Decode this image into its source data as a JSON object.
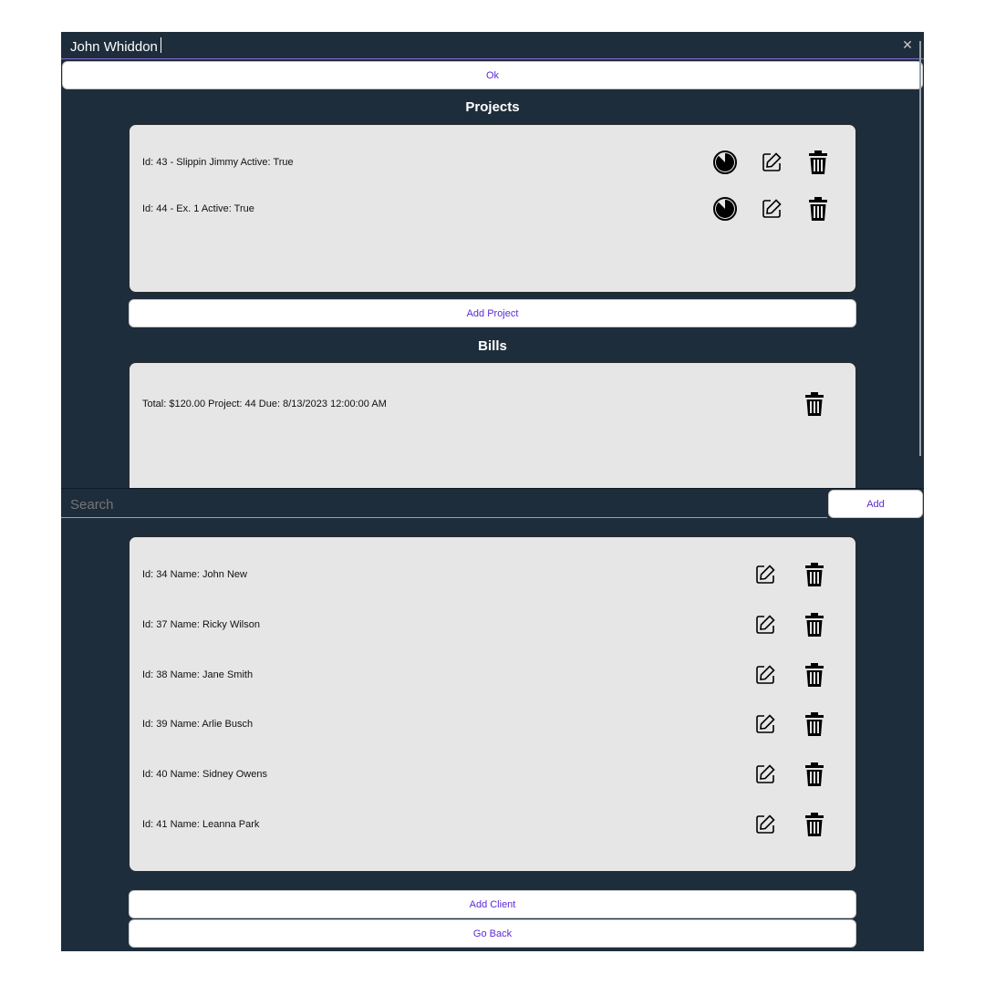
{
  "client_edit": {
    "name_value": "John Whiddon",
    "ok_label": "Ok"
  },
  "projects": {
    "title": "Projects",
    "items": [
      {
        "label": "Id: 43 - Slippin Jimmy Active: True"
      },
      {
        "label": "Id: 44 - Ex. 1 Active: True"
      }
    ],
    "add_label": "Add Project"
  },
  "bills": {
    "title": "Bills",
    "items": [
      {
        "label": "Total: $120.00 Project: 44 Due: 8/13/2023 12:00:00 AM"
      }
    ]
  },
  "clients": {
    "search_placeholder": "Search",
    "add_label": "Add",
    "items": [
      {
        "label": "Id: 34 Name: John New"
      },
      {
        "label": "Id: 37 Name: Ricky Wilson"
      },
      {
        "label": "Id: 38 Name: Jane Smith"
      },
      {
        "label": "Id: 39 Name: Arlie Busch"
      },
      {
        "label": "Id: 40 Name: Sidney Owens"
      },
      {
        "label": "Id: 41 Name: Leanna Park"
      }
    ],
    "add_client_label": "Add Client",
    "go_back_label": "Go Back"
  },
  "icons": {
    "close": "close-icon",
    "timer": "timer-icon",
    "edit": "edit-icon",
    "delete": "trash-icon"
  },
  "colors": {
    "background": "#1e2d3b",
    "panel": "#e6e6e6",
    "button_text": "#5b2ad6"
  }
}
